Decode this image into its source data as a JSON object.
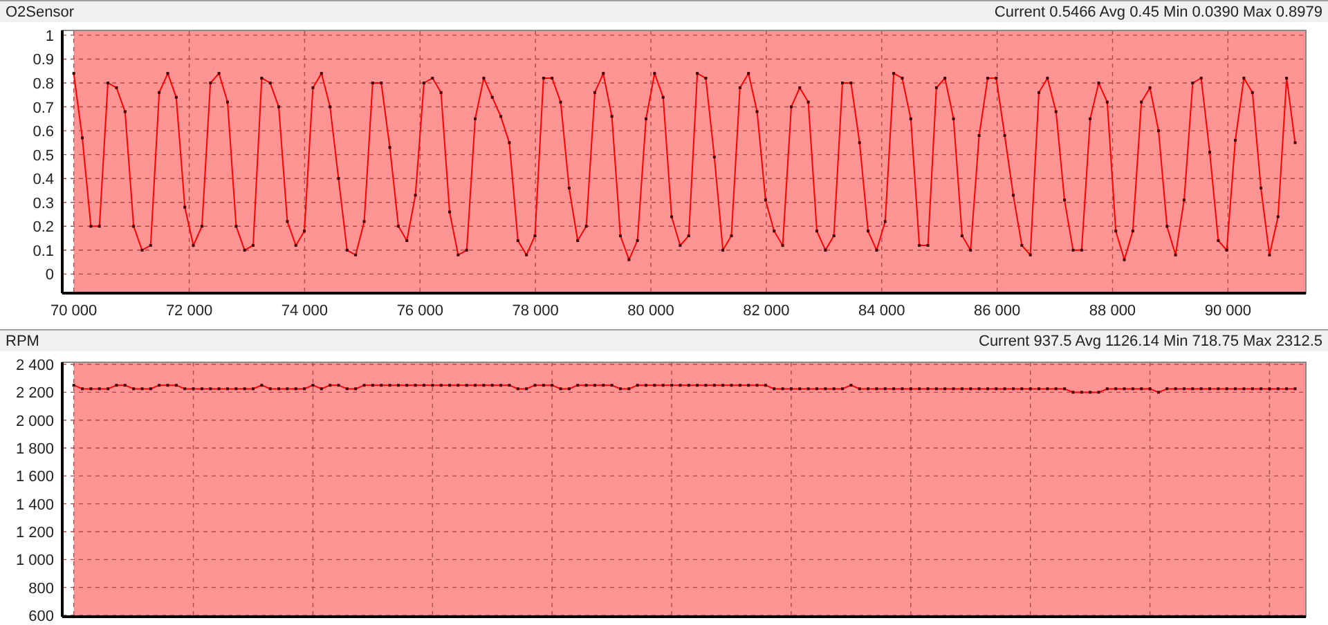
{
  "panels": [
    {
      "title": "O2Sensor",
      "stats": "Current 0.5466 Avg 0.45 Min 0.0390 Max 0.8979",
      "chart_data": {
        "type": "line",
        "grid": true,
        "xlim": [
          69800,
          91350
        ],
        "ylim": [
          -0.08,
          1.02
        ],
        "xticks": [
          {
            "value": 70000,
            "label": "70 000"
          },
          {
            "value": 72000,
            "label": "72 000"
          },
          {
            "value": 74000,
            "label": "74 000"
          },
          {
            "value": 76000,
            "label": "76 000"
          },
          {
            "value": 78000,
            "label": "78 000"
          },
          {
            "value": 80000,
            "label": "80 000"
          },
          {
            "value": 82000,
            "label": "82 000"
          },
          {
            "value": 84000,
            "label": "84 000"
          },
          {
            "value": 86000,
            "label": "86 000"
          },
          {
            "value": 88000,
            "label": "88 000"
          },
          {
            "value": 90000,
            "label": "90 000"
          }
        ],
        "yticks": [
          0,
          0.1,
          0.2,
          0.3,
          0.4,
          0.5,
          0.6,
          0.7,
          0.8,
          0.9,
          1
        ],
        "x": [
          70000,
          70148,
          70296,
          70444,
          70592,
          70740,
          70888,
          71036,
          71184,
          71332,
          71480,
          71628,
          71776,
          71924,
          72072,
          72220,
          72368,
          72516,
          72664,
          72812,
          72960,
          73108,
          73256,
          73404,
          73552,
          73700,
          73848,
          73996,
          74144,
          74292,
          74440,
          74588,
          74736,
          74884,
          75032,
          75180,
          75328,
          75476,
          75624,
          75772,
          75920,
          76068,
          76216,
          76364,
          76512,
          76660,
          76808,
          76956,
          77104,
          77252,
          77400,
          77548,
          77696,
          77844,
          77992,
          78140,
          78288,
          78436,
          78584,
          78732,
          78880,
          79028,
          79176,
          79324,
          79472,
          79620,
          79768,
          79916,
          80064,
          80212,
          80360,
          80508,
          80656,
          80804,
          80952,
          81100,
          81248,
          81396,
          81544,
          81692,
          81840,
          81988,
          82136,
          82284,
          82432,
          82580,
          82728,
          82876,
          83024,
          83172,
          83320,
          83468,
          83616,
          83764,
          83912,
          84060,
          84208,
          84356,
          84504,
          84652,
          84800,
          84948,
          85096,
          85244,
          85392,
          85540,
          85688,
          85836,
          85984,
          86132,
          86280,
          86428,
          86576,
          86724,
          86872,
          87020,
          87168,
          87316,
          87464,
          87612,
          87760,
          87908,
          88056,
          88204,
          88352,
          88500,
          88648,
          88796,
          88944,
          89092,
          89240,
          89388,
          89536,
          89684,
          89832,
          89980,
          90128,
          90276,
          90424,
          90572,
          90720,
          90868,
          91016,
          91164
        ],
        "series": [
          {
            "color": "#ff0000",
            "marker": "square",
            "values": [
              0.84,
              0.57,
              0.2,
              0.2,
              0.8,
              0.78,
              0.68,
              0.2,
              0.1,
              0.12,
              0.76,
              0.84,
              0.74,
              0.28,
              0.12,
              0.2,
              0.8,
              0.84,
              0.72,
              0.2,
              0.1,
              0.12,
              0.82,
              0.8,
              0.7,
              0.22,
              0.12,
              0.18,
              0.78,
              0.84,
              0.7,
              0.4,
              0.1,
              0.08,
              0.22,
              0.8,
              0.8,
              0.53,
              0.2,
              0.14,
              0.33,
              0.8,
              0.82,
              0.76,
              0.26,
              0.08,
              0.1,
              0.65,
              0.82,
              0.74,
              0.66,
              0.55,
              0.14,
              0.08,
              0.16,
              0.82,
              0.82,
              0.72,
              0.36,
              0.14,
              0.2,
              0.76,
              0.84,
              0.66,
              0.16,
              0.06,
              0.14,
              0.65,
              0.84,
              0.74,
              0.24,
              0.12,
              0.16,
              0.84,
              0.82,
              0.49,
              0.1,
              0.16,
              0.78,
              0.84,
              0.68,
              0.31,
              0.18,
              0.12,
              0.7,
              0.78,
              0.72,
              0.18,
              0.1,
              0.16,
              0.8,
              0.8,
              0.55,
              0.18,
              0.1,
              0.22,
              0.84,
              0.82,
              0.65,
              0.12,
              0.12,
              0.78,
              0.82,
              0.65,
              0.16,
              0.1,
              0.58,
              0.82,
              0.82,
              0.58,
              0.33,
              0.12,
              0.08,
              0.76,
              0.82,
              0.68,
              0.31,
              0.1,
              0.1,
              0.65,
              0.8,
              0.72,
              0.18,
              0.06,
              0.18,
              0.72,
              0.78,
              0.6,
              0.2,
              0.08,
              0.31,
              0.8,
              0.82,
              0.51,
              0.14,
              0.1,
              0.56,
              0.82,
              0.76,
              0.36,
              0.08,
              0.24,
              0.82,
              0.55
            ]
          }
        ]
      }
    },
    {
      "title": "RPM",
      "stats": "Current 937.5 Avg 1126.14 Min 718.75 Max 2312.5",
      "chart_data": {
        "type": "line",
        "grid": true,
        "xlim": [
          69800,
          91350
        ],
        "ylim": [
          590,
          2415
        ],
        "yticks": [
          {
            "value": 600,
            "label": "600"
          },
          {
            "value": 800,
            "label": "800"
          },
          {
            "value": 1000,
            "label": "1 000"
          },
          {
            "value": 1200,
            "label": "1 200"
          },
          {
            "value": 1400,
            "label": "1 400"
          },
          {
            "value": 1600,
            "label": "1 600"
          },
          {
            "value": 1800,
            "label": "1 800"
          },
          {
            "value": 2000,
            "label": "2 000"
          },
          {
            "value": 2200,
            "label": "2 200"
          },
          {
            "value": 2400,
            "label": "2 400"
          }
        ],
        "x": [
          70000,
          70148,
          70296,
          70444,
          70592,
          70740,
          70888,
          71036,
          71184,
          71332,
          71480,
          71628,
          71776,
          71924,
          72072,
          72220,
          72368,
          72516,
          72664,
          72812,
          72960,
          73108,
          73256,
          73404,
          73552,
          73700,
          73848,
          73996,
          74144,
          74292,
          74440,
          74588,
          74736,
          74884,
          75032,
          75180,
          75328,
          75476,
          75624,
          75772,
          75920,
          76068,
          76216,
          76364,
          76512,
          76660,
          76808,
          76956,
          77104,
          77252,
          77400,
          77548,
          77696,
          77844,
          77992,
          78140,
          78288,
          78436,
          78584,
          78732,
          78880,
          79028,
          79176,
          79324,
          79472,
          79620,
          79768,
          79916,
          80064,
          80212,
          80360,
          80508,
          80656,
          80804,
          80952,
          81100,
          81248,
          81396,
          81544,
          81692,
          81840,
          81988,
          82136,
          82284,
          82432,
          82580,
          82728,
          82876,
          83024,
          83172,
          83320,
          83468,
          83616,
          83764,
          83912,
          84060,
          84208,
          84356,
          84504,
          84652,
          84800,
          84948,
          85096,
          85244,
          85392,
          85540,
          85688,
          85836,
          85984,
          86132,
          86280,
          86428,
          86576,
          86724,
          86872,
          87020,
          87168,
          87316,
          87464,
          87612,
          87760,
          87908,
          88056,
          88204,
          88352,
          88500,
          88648,
          88796,
          88944,
          89092,
          89240,
          89388,
          89536,
          89684,
          89832,
          89980,
          90128,
          90276,
          90424,
          90572,
          90720,
          90868,
          91016,
          91164
        ],
        "series": [
          {
            "color": "#ff0000",
            "marker": "square",
            "values": [
              2250,
              2225,
              2225,
              2225,
              2225,
              2250,
              2250,
              2225,
              2225,
              2225,
              2250,
              2250,
              2250,
              2225,
              2225,
              2225,
              2225,
              2225,
              2225,
              2225,
              2225,
              2225,
              2250,
              2225,
              2225,
              2225,
              2225,
              2225,
              2250,
              2225,
              2250,
              2250,
              2225,
              2225,
              2250,
              2250,
              2250,
              2250,
              2250,
              2250,
              2250,
              2250,
              2250,
              2250,
              2250,
              2250,
              2250,
              2250,
              2250,
              2250,
              2250,
              2250,
              2225,
              2225,
              2250,
              2250,
              2250,
              2225,
              2225,
              2250,
              2250,
              2250,
              2250,
              2250,
              2225,
              2225,
              2250,
              2250,
              2250,
              2250,
              2250,
              2250,
              2250,
              2250,
              2250,
              2250,
              2250,
              2250,
              2250,
              2250,
              2250,
              2250,
              2225,
              2225,
              2225,
              2225,
              2225,
              2225,
              2225,
              2225,
              2225,
              2250,
              2225,
              2225,
              2225,
              2225,
              2225,
              2225,
              2225,
              2225,
              2225,
              2225,
              2225,
              2225,
              2225,
              2225,
              2225,
              2225,
              2225,
              2225,
              2225,
              2225,
              2225,
              2225,
              2225,
              2225,
              2225,
              2200,
              2200,
              2200,
              2200,
              2225,
              2225,
              2225,
              2225,
              2225,
              2225,
              2200,
              2225,
              2225,
              2225,
              2225,
              2225,
              2225,
              2225,
              2225,
              2225,
              2225,
              2225,
              2225,
              2225,
              2225,
              2225,
              2225
            ]
          }
        ]
      }
    }
  ]
}
